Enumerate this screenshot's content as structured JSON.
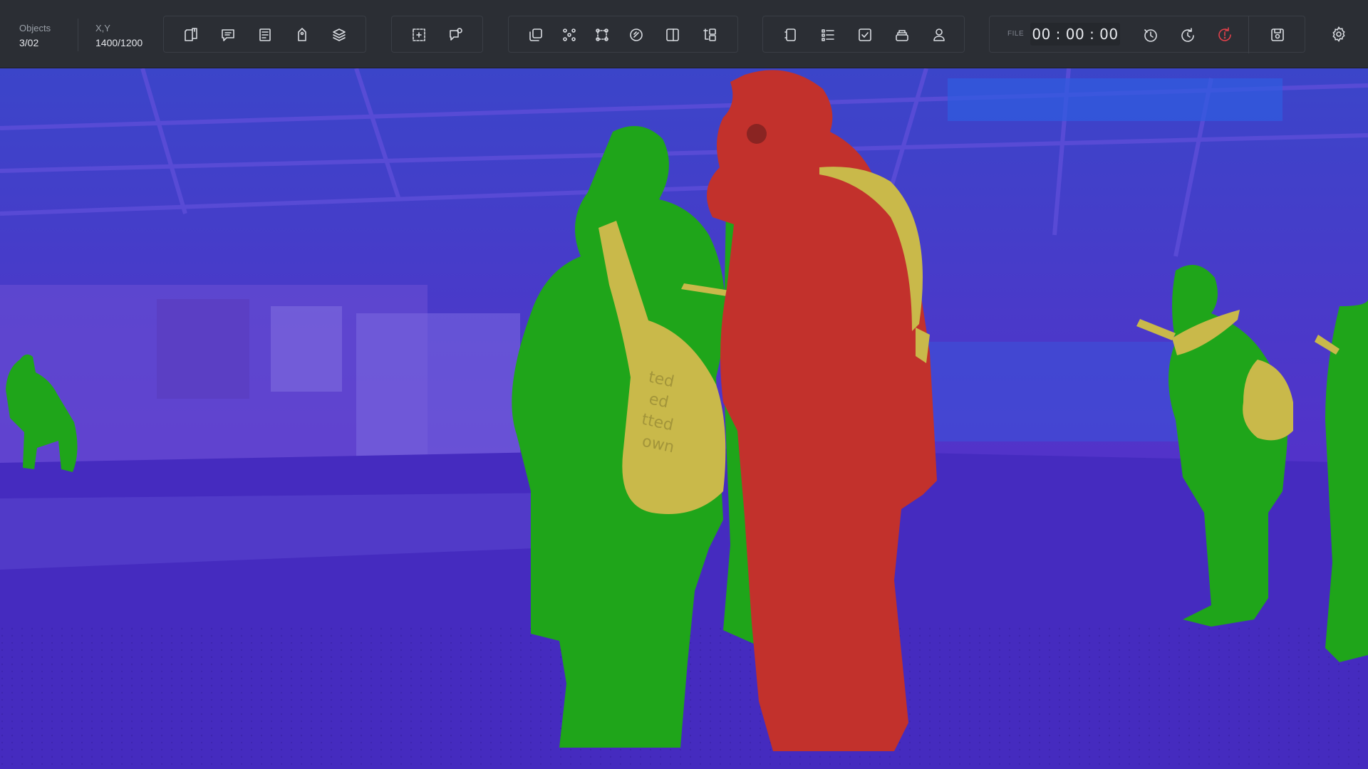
{
  "header": {
    "objects_label": "Objects",
    "objects_value": "3/02",
    "xy_label": "X,Y",
    "xy_value": "1400/1200"
  },
  "toolbar": {
    "group1": [
      {
        "icon": "new-document-icon"
      },
      {
        "icon": "comment-icon"
      },
      {
        "icon": "list-document-icon"
      },
      {
        "icon": "tag-icon"
      },
      {
        "icon": "layers-icon"
      }
    ],
    "group2": [
      {
        "icon": "select-region-icon"
      },
      {
        "icon": "comment-pin-icon"
      }
    ],
    "group3": [
      {
        "icon": "copy-icon"
      },
      {
        "icon": "polygon-points-icon"
      },
      {
        "icon": "bounding-box-icon"
      },
      {
        "icon": "mask-brush-icon"
      },
      {
        "icon": "split-view-icon"
      },
      {
        "icon": "arrange-icon"
      }
    ],
    "group4": [
      {
        "icon": "page-icon"
      },
      {
        "icon": "checklist-icon"
      },
      {
        "icon": "approve-icon"
      },
      {
        "icon": "stack-icon"
      },
      {
        "icon": "user-icon"
      }
    ],
    "group5": [
      {
        "icon": "history-icon"
      },
      {
        "icon": "redo-time-icon"
      },
      {
        "icon": "alert-timer-icon",
        "color": "#e0404a"
      }
    ],
    "file_label": "FILE",
    "timer": "00 : 00 : 00",
    "save_icon": "save-icon",
    "settings_icon": "gear-icon"
  },
  "segmentation": {
    "classes": [
      {
        "name": "background",
        "color": "#4a2fd0"
      },
      {
        "name": "person",
        "color": "#1fa51a"
      },
      {
        "name": "bag",
        "color": "#c9b94a"
      },
      {
        "name": "selected-person",
        "color": "#c2312c"
      }
    ],
    "bag_text": [
      "ted",
      "ed",
      "tted",
      "own"
    ]
  }
}
